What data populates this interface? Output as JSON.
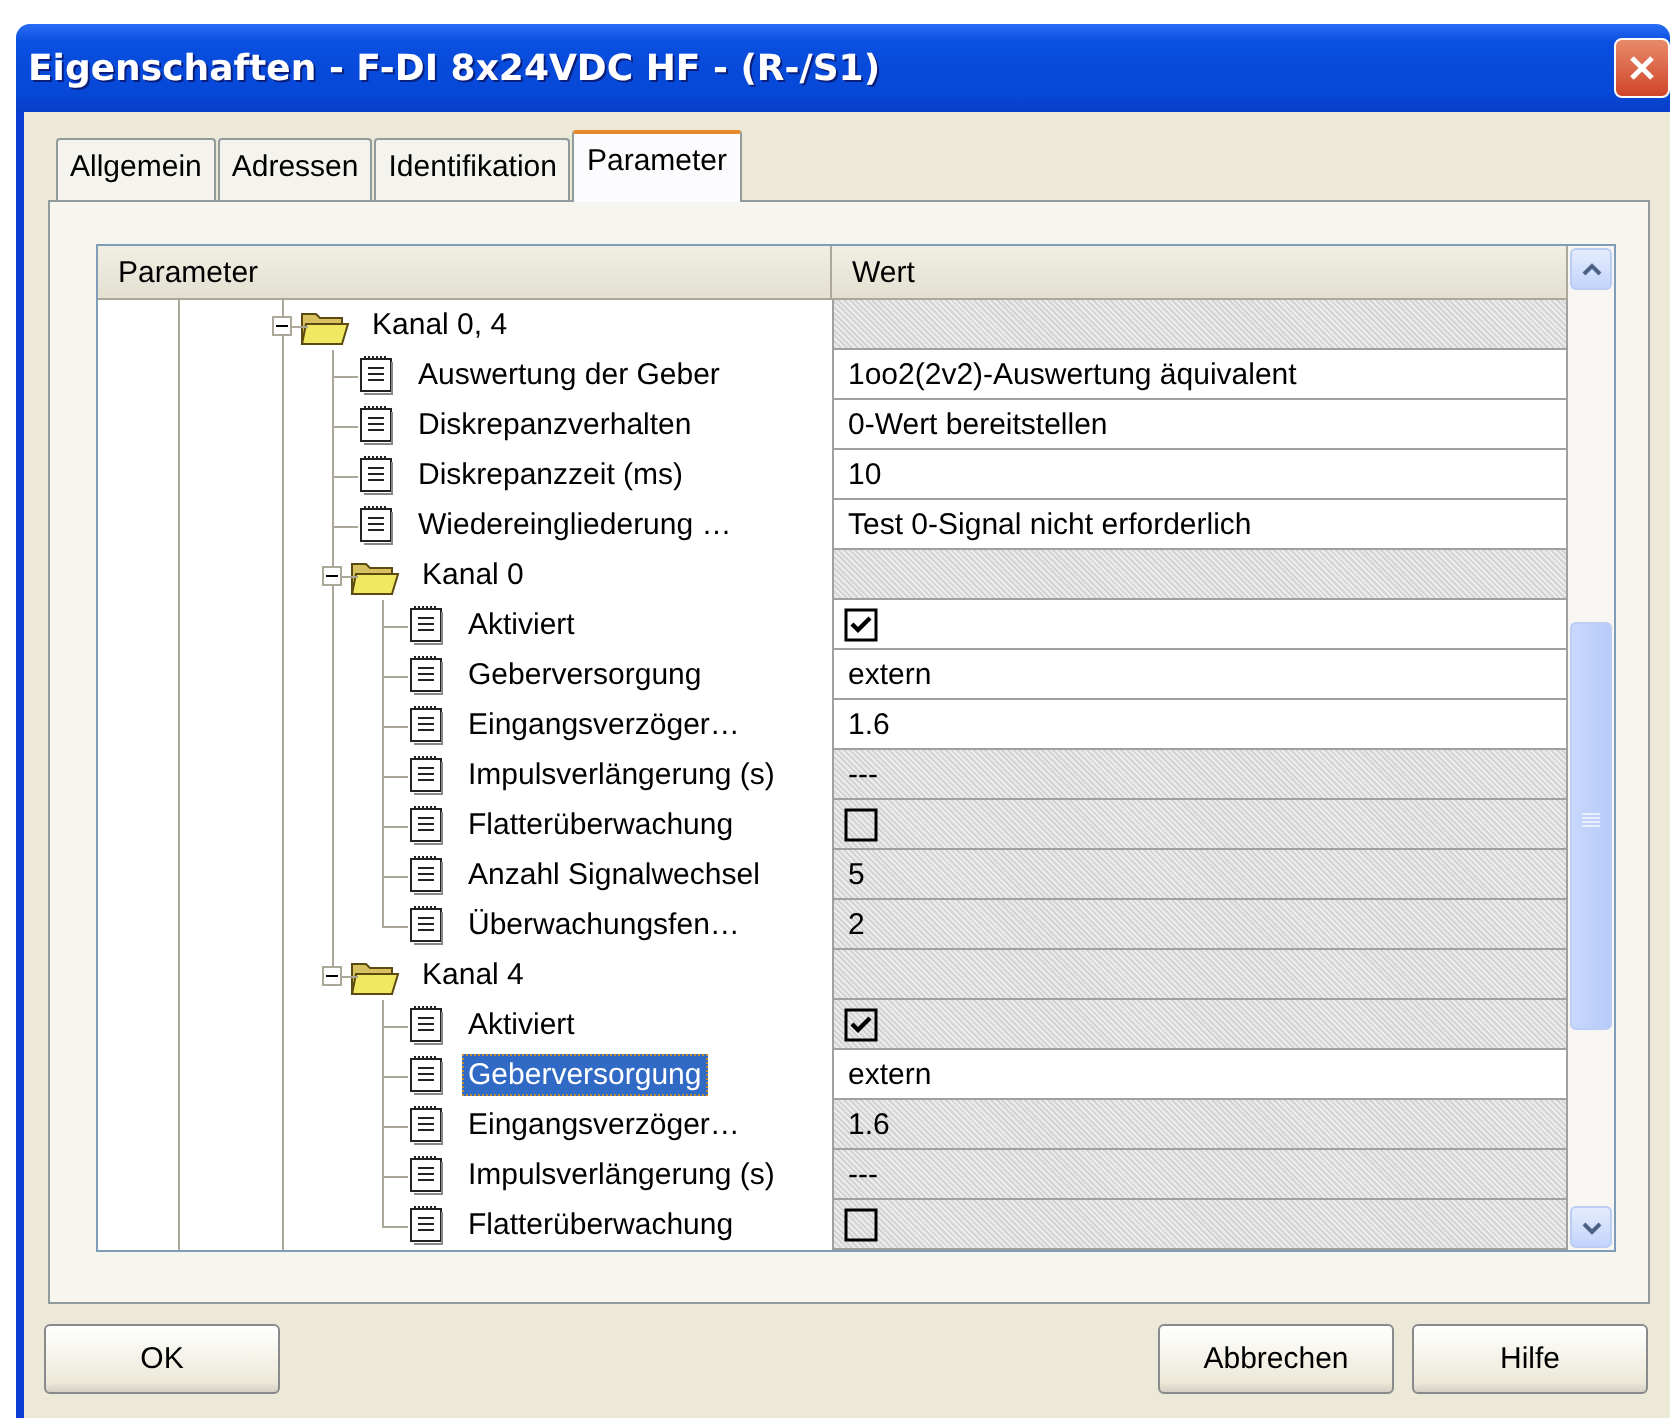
{
  "window": {
    "title": "Eigenschaften - F-DI 8x24VDC HF - (R-/S1)"
  },
  "tabs": [
    {
      "label": "Allgemein",
      "selected": false
    },
    {
      "label": "Adressen",
      "selected": false
    },
    {
      "label": "Identifikation",
      "selected": false
    },
    {
      "label": "Parameter",
      "selected": true
    }
  ],
  "table": {
    "columns": [
      "Parameter",
      "Wert"
    ],
    "tree": [
      {
        "label": "Kanal 0, 4",
        "kind": "group",
        "expanded": true,
        "selected": false,
        "children": [
          {
            "label": "Auswertung der Geber",
            "kind": "text",
            "value": "1oo2(2v2)-Auswertung äquivalent",
            "editable": true,
            "selected": false
          },
          {
            "label": "Diskrepanzverhalten",
            "kind": "text",
            "value": "0-Wert bereitstellen",
            "editable": true,
            "selected": false
          },
          {
            "label": "Diskrepanzzeit (ms)",
            "kind": "text",
            "value": "10",
            "editable": true,
            "selected": false
          },
          {
            "label": "Wiedereingliederung …",
            "kind": "text",
            "value": "Test 0-Signal nicht erforderlich",
            "editable": true,
            "selected": false
          },
          {
            "label": "Kanal 0",
            "kind": "group",
            "expanded": true,
            "selected": false,
            "children": [
              {
                "label": "Aktiviert",
                "kind": "checkbox",
                "checked": true,
                "editable": true,
                "selected": false
              },
              {
                "label": "Geberversorgung",
                "kind": "text",
                "value": "extern",
                "editable": true,
                "selected": false
              },
              {
                "label": "Eingangsverzöger…",
                "kind": "text",
                "value": "1.6",
                "editable": true,
                "selected": false
              },
              {
                "label": "Impulsverlängerung (s)",
                "kind": "text",
                "value": "---",
                "editable": false,
                "selected": false
              },
              {
                "label": "Flatterüberwachung",
                "kind": "checkbox",
                "checked": false,
                "editable": false,
                "selected": false
              },
              {
                "label": "Anzahl Signalwechsel",
                "kind": "text",
                "value": "5",
                "editable": false,
                "selected": false
              },
              {
                "label": "Überwachungsfen…",
                "kind": "text",
                "value": "2",
                "editable": false,
                "selected": false
              }
            ]
          },
          {
            "label": "Kanal 4",
            "kind": "group",
            "expanded": true,
            "selected": false,
            "children": [
              {
                "label": "Aktiviert",
                "kind": "checkbox",
                "checked": true,
                "editable": false,
                "selected": false
              },
              {
                "label": "Geberversorgung",
                "kind": "text",
                "value": "extern",
                "editable": true,
                "selected": true
              },
              {
                "label": "Eingangsverzöger…",
                "kind": "text",
                "value": "1.6",
                "editable": false,
                "selected": false
              },
              {
                "label": "Impulsverlängerung (s)",
                "kind": "text",
                "value": "---",
                "editable": false,
                "selected": false
              },
              {
                "label": "Flatterüberwachung",
                "kind": "checkbox",
                "checked": false,
                "editable": false,
                "selected": false
              }
            ]
          }
        ]
      }
    ]
  },
  "buttons": [
    "OK",
    "Abbrechen",
    "Hilfe"
  ]
}
